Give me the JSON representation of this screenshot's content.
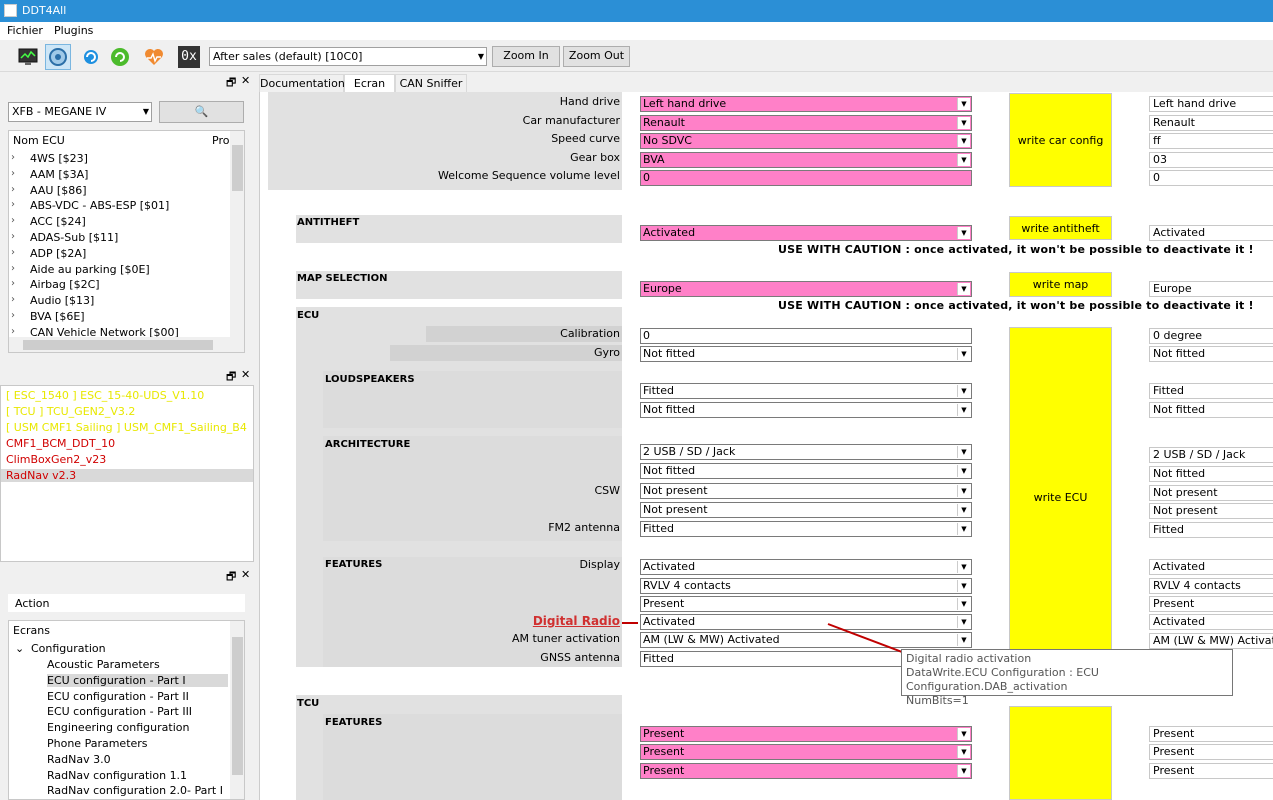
{
  "window": {
    "title": "DDT4All"
  },
  "menu": [
    "Fichier",
    "Plugins"
  ],
  "toolbar": {
    "icons": [
      "monitor-icon",
      "ecu-scan-icon",
      "refresh-icon",
      "reload-icon",
      "heartbeat-icon",
      "hex-icon"
    ],
    "hex_label": "0x",
    "session_select": "After sales (default) [10C0]",
    "zoom_in": "Zoom In",
    "zoom_out": "Zoom Out"
  },
  "vehicle_panel": {
    "vehicle_select": "XFB - MEGANE IV",
    "col_name": "Nom ECU",
    "col_pro": "Pro",
    "ecus": [
      "4WS [$23]",
      "AAM [$3A]",
      "AAU [$86]",
      "ABS-VDC - ABS-ESP [$01]",
      "ACC [$24]",
      "ADAS-Sub [$11]",
      "ADP [$2A]",
      "Aide au parking [$0E]",
      "Airbag [$2C]",
      "Audio [$13]",
      "BVA [$6E]",
      "CAN Vehicle Network [$00]"
    ]
  },
  "projects": {
    "items": [
      {
        "label": "[ ESC_1540 ] ESC_15-40-UDS_V1.10",
        "color": "#e8e800"
      },
      {
        "label": "[ TCU ] TCU_GEN2_V3.2",
        "color": "#e8e800"
      },
      {
        "label": "[ USM CMF1 Sailing ] USM_CMF1_Sailing_B4",
        "color": "#e8e800"
      },
      {
        "label": "CMF1_BCM_DDT_10",
        "color": "#d00000"
      },
      {
        "label": "ClimBoxGen2_v23",
        "color": "#d00000"
      },
      {
        "label": "RadNav v2.3",
        "color": "#d00000"
      }
    ]
  },
  "screens_panel": {
    "action_label": "Action",
    "tree_header": "Ecrans",
    "group": "Configuration",
    "items": [
      "Acoustic Parameters",
      "ECU configuration - Part I",
      "ECU configuration - Part II",
      "ECU configuration - Part III",
      "Engineering configuration",
      "Phone Parameters",
      "RadNav 3.0",
      "RadNav configuration 1.1",
      "RadNav configuration 2.0- Part I"
    ],
    "selected": "ECU configuration - Part I"
  },
  "tabs": [
    "Documentation",
    "Ecran",
    "CAN Sniffer"
  ],
  "screen": {
    "car_config": {
      "labels": [
        "Hand drive",
        "Car manufacturer",
        "Speed curve",
        "Gear box",
        "Welcome Sequence volume level"
      ],
      "values": [
        "Left hand drive",
        "Renault",
        "No SDVC",
        "BVA",
        "0"
      ],
      "read": [
        "Left hand drive",
        "Renault",
        "ff",
        "03",
        "0"
      ],
      "button": "write car config"
    },
    "antitheft": {
      "title": "ANTITHEFT",
      "value": "Activated",
      "read": "Activated",
      "button": "write antitheft"
    },
    "caution": "USE WITH CAUTION : once activated, it won't be possible to deactivate it !",
    "map": {
      "title": "MAP SELECTION",
      "value": "Europe",
      "read": "Europe",
      "button": "write map"
    },
    "ecu": {
      "title": "ECU",
      "calibration_label": "Calibration",
      "calibration": "0",
      "calibration_read": "0 degree",
      "gyro_label": "Gyro",
      "gyro": "Not fitted",
      "gyro_read": "Not fitted",
      "loudspeakers_title": "LOUDSPEAKERS",
      "loudspeakers": [
        "Fitted",
        "Not fitted"
      ],
      "loudspeakers_read": [
        "Fitted",
        "Not fitted"
      ],
      "architecture_title": "ARCHITECTURE",
      "architecture": [
        "2 USB / SD / Jack",
        "Not fitted",
        "Not present",
        "Not present",
        "Fitted"
      ],
      "architecture_read": [
        "2 USB / SD / Jack",
        "Not fitted",
        "Not present",
        "Not present",
        "Fitted"
      ],
      "csw_label": "CSW",
      "fm2_label": "FM2 antenna",
      "features_title": "FEATURES",
      "display_label": "Display",
      "features": [
        "Activated",
        "RVLV 4 contacts",
        "Present",
        "Activated",
        "AM (LW & MW) Activated"
      ],
      "features_read": [
        "Activated",
        "RVLV 4 contacts",
        "Present",
        "Activated",
        "AM (LW & MW) Activated"
      ],
      "digital_radio_label": "Digital Radio",
      "am_label": "AM tuner activation",
      "gnss_label": "GNSS antenna",
      "gnss": "Fitted",
      "button": "write ECU"
    },
    "tcu": {
      "title": "TCU",
      "features_title": "FEATURES",
      "values": [
        "Present",
        "Present",
        "Present"
      ],
      "read": [
        "Present",
        "Present",
        "Present"
      ]
    },
    "tooltip": [
      "Digital radio activation",
      "DataWrite.ECU Configuration : ECU Configuration.DAB_activation",
      "NumBits=1"
    ]
  }
}
